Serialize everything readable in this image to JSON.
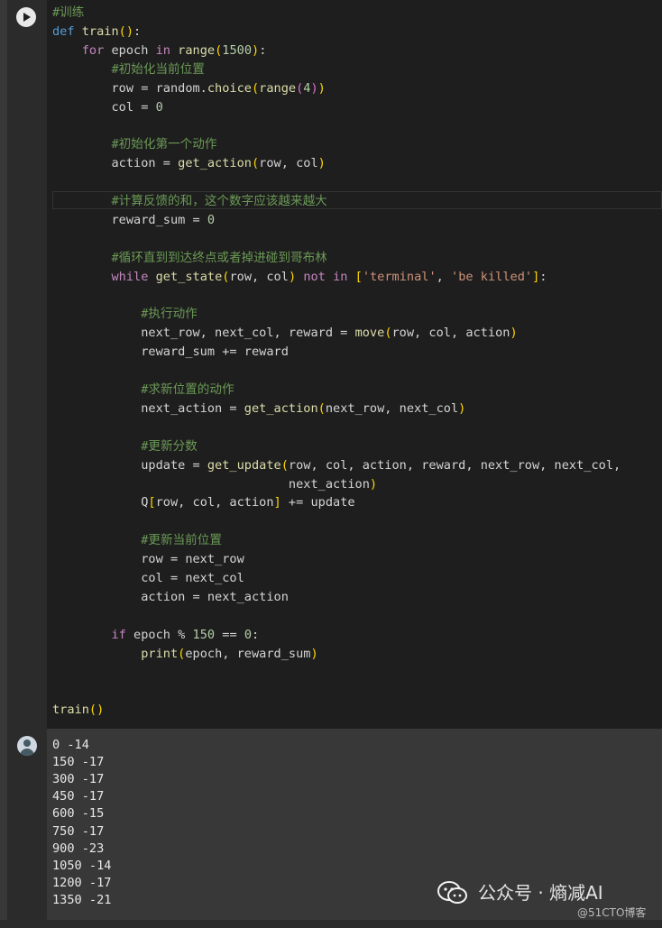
{
  "code": {
    "lines": [
      "#训练",
      "def train():",
      "    for epoch in range(1500):",
      "        #初始化当前位置",
      "        row = random.choice(range(4))",
      "        col = 0",
      "",
      "        #初始化第一个动作",
      "        action = get_action(row, col)",
      "",
      "        #计算反馈的和，这个数字应该越来越大",
      "        reward_sum = 0",
      "",
      "        #循环直到到达终点或者掉进碰到哥布林",
      "        while get_state(row, col) not in ['terminal', 'be killed']:",
      "",
      "            #执行动作",
      "            next_row, next_col, reward = move(row, col, action)",
      "            reward_sum += reward",
      "",
      "            #求新位置的动作",
      "            next_action = get_action(next_row, next_col)",
      "",
      "            #更新分数",
      "            update = get_update(row, col, action, reward, next_row, next_col,",
      "                                next_action)",
      "            Q[row, col, action] += update",
      "",
      "            #更新当前位置",
      "            row = next_row",
      "            col = next_col",
      "            action = next_action",
      "",
      "        if epoch % 150 == 0:",
      "            print(epoch, reward_sum)",
      "",
      "",
      "train()"
    ]
  },
  "output": {
    "lines": [
      "0 -14",
      "150 -17",
      "300 -17",
      "450 -17",
      "600 -15",
      "750 -17",
      "900 -23",
      "1050 -14",
      "1200 -17",
      "1350 -21"
    ]
  },
  "watermark": {
    "main": "公众号 · 熵减AI",
    "sub": "@51CTO博客"
  },
  "icons": {
    "run": "play-icon",
    "output": "user-avatar-icon",
    "watermark": "wechat-icon"
  }
}
